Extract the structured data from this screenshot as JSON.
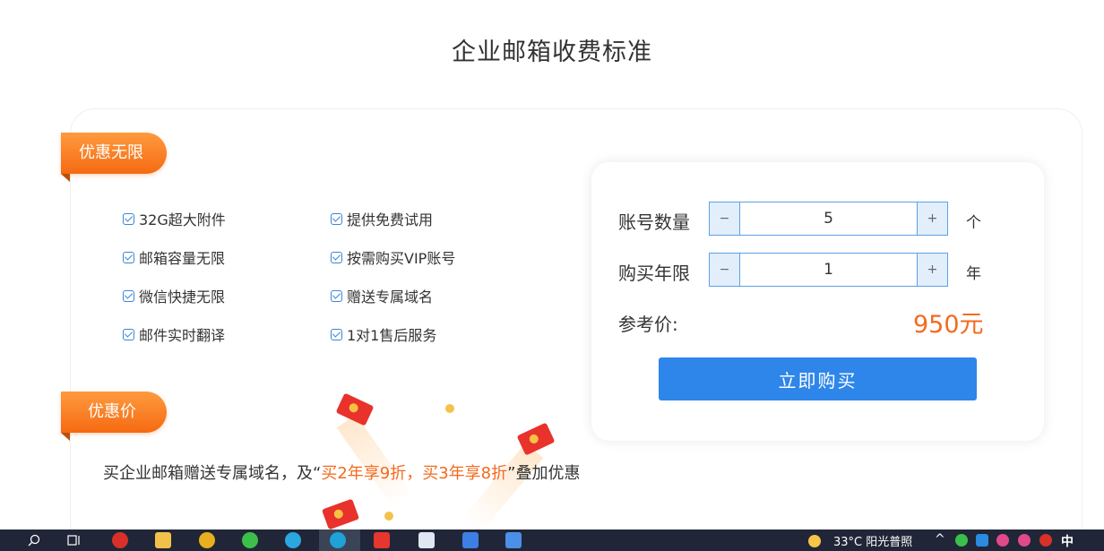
{
  "page": {
    "title": "企业邮箱收费标准"
  },
  "benefits": {
    "ribbon_label": "优惠无限",
    "features": [
      "32G超大附件",
      "邮箱容量无限",
      "微信快捷无限",
      "邮件实时翻译",
      "提供免费试用",
      "按需购买VIP账号",
      "赠送专属域名",
      "1对1售后服务"
    ]
  },
  "discount": {
    "ribbon_label": "优惠价",
    "promo_prefix": "买企业邮箱赠送专属域名，及“",
    "promo_highlight": "买2年享9折，买3年享8折",
    "promo_suffix": "”叠加优惠"
  },
  "calculator": {
    "accounts_label": "账号数量",
    "accounts_value": "5",
    "accounts_unit": "个",
    "years_label": "购买年限",
    "years_value": "1",
    "years_unit": "年",
    "minus_symbol": "−",
    "plus_symbol": "+",
    "price_label": "参考价:",
    "price_value": "950元",
    "buy_label": "立即购买"
  },
  "taskbar": {
    "weather": "33°C  阳光普照",
    "ime": "中",
    "chevron": "^"
  },
  "colors": {
    "accent_blue": "#2e86ea",
    "accent_orange": "#f46a20",
    "taskbar_bg": "#202637"
  }
}
